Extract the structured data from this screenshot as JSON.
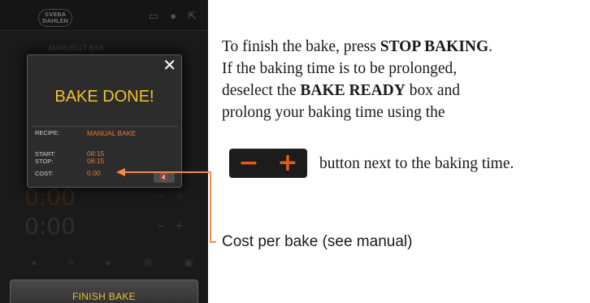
{
  "device": {
    "logo": "SVEBA DAHLÉN",
    "top_icons": [
      "screen-icon",
      "user-icon",
      "export-icon"
    ],
    "background_label": "MANUELLT BAK",
    "finish_button": "FINISH BAKE"
  },
  "dialog": {
    "close_symbol": "✕",
    "title": "BAKE DONE!",
    "recipe_label": "RECIPE:",
    "recipe_value": "MANUAL BAKE",
    "start_label": "START:",
    "start_value": "08:15",
    "stop_label": "STOP:",
    "stop_value": "08:15",
    "cost_label": "COST:",
    "cost_value": "0.00",
    "mute_icon": "mute-icon"
  },
  "instructions": {
    "intro": "To finish the bake, press",
    "stop_baking": "STOP BAKING",
    "line2": "If the baking time is to be prolonged,",
    "deselect": "deselect the",
    "bake_ready": "BAKE READY",
    "box_and": "box and",
    "line4": "prolong your baking time using the",
    "minus": "−",
    "plus": "+",
    "after_button": "button next to the baking time."
  },
  "cost_note": "Cost per bake (see manual)",
  "colors": {
    "accent_orange": "#ec5a10",
    "title_yellow": "#f0c428",
    "annotation_line": "#f08a4a"
  }
}
